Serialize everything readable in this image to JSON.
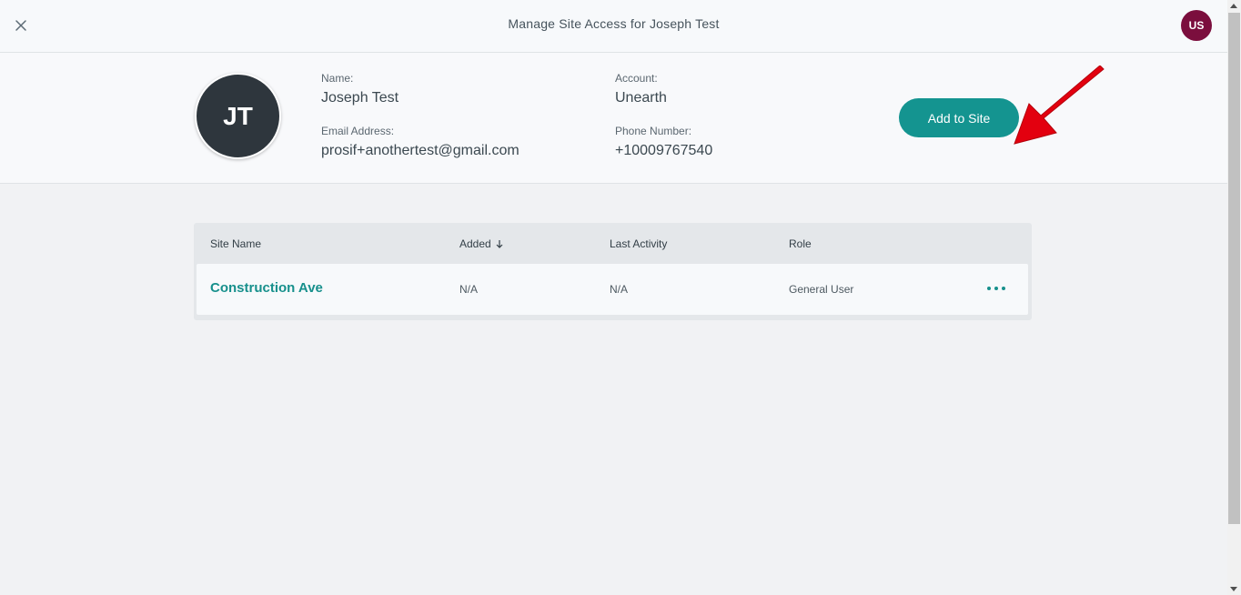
{
  "header": {
    "close_icon": "close-icon",
    "title": "Manage Site Access for Joseph Test",
    "user_initials": "US",
    "user_color": "#7b0e3d"
  },
  "profile": {
    "initials": "JT",
    "name_label": "Name:",
    "name": "Joseph Test",
    "email_label": "Email Address:",
    "email": "prosif+anothertest@gmail.com",
    "account_label": "Account:",
    "account": "Unearth",
    "phone_label": "Phone Number:",
    "phone": "+10009767540",
    "add_button": "Add to Site",
    "accent_color": "#149490",
    "annotation_arrow_color": "#e3000f"
  },
  "table": {
    "columns": [
      "Site Name",
      "Added",
      "Last Activity",
      "Role"
    ],
    "sort_icon": "arrow-down-icon",
    "rows": [
      {
        "site_name": "Construction Ave",
        "added": "N/A",
        "last_activity": "N/A",
        "role": "General User",
        "actions_icon": "more-horizontal-icon"
      }
    ]
  }
}
